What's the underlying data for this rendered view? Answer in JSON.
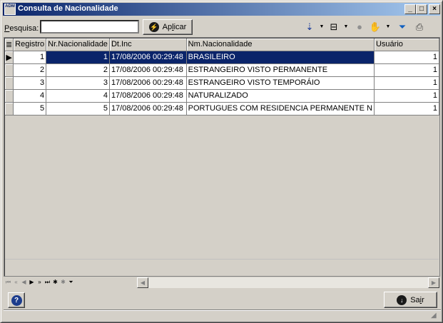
{
  "window": {
    "title": "Consulta de Nacionalidade",
    "app_icon_text": "ADM",
    "minimize_glyph": "_",
    "maximize_glyph": "□",
    "close_glyph": "×"
  },
  "search": {
    "label_underlined": "P",
    "label_rest": "esquisa:",
    "value": "",
    "placeholder": ""
  },
  "apply_button": {
    "label_pre": "Ap",
    "label_underlined": "l",
    "label_post": "icar"
  },
  "toolbar_icons": [
    "sort-icon",
    "layout-icon",
    "record-icon",
    "hand-icon",
    "filter-icon",
    "print-icon"
  ],
  "grid": {
    "columns": [
      "Registro",
      "Nr.Nacionalidade",
      "Dt.Inc",
      "Nm.Nacionalidade",
      "Usuário"
    ],
    "rows": [
      {
        "registro": "1",
        "nr": "1",
        "dt": "17/08/2006 00:29:48",
        "nm": "BRASILEIRO",
        "usuario": "1"
      },
      {
        "registro": "2",
        "nr": "2",
        "dt": "17/08/2006 00:29:48",
        "nm": "ESTRANGEIRO VISTO PERMANENTE",
        "usuario": "1"
      },
      {
        "registro": "3",
        "nr": "3",
        "dt": "17/08/2006 00:29:48",
        "nm": "ESTRANGEIRO VISTO TEMPORÁIO",
        "usuario": "1"
      },
      {
        "registro": "4",
        "nr": "4",
        "dt": "17/08/2006 00:29:48",
        "nm": "NATURALIZADO",
        "usuario": "1"
      },
      {
        "registro": "5",
        "nr": "5",
        "dt": "17/08/2006 00:29:48",
        "nm": "PORTUGUES COM RESIDENCIA PERMANENTE N",
        "usuario": "1"
      }
    ],
    "selected_row": 0,
    "row_indicator": "▶"
  },
  "navigator": {
    "first": "⏮",
    "prior_page": "«",
    "prior": "◀",
    "next": "▶",
    "next_page": "»",
    "last": "⏭",
    "insert": "✱",
    "delete": "✱",
    "filter": "⏷"
  },
  "exit_button": {
    "label_pre": "Sa",
    "label_underlined": "i",
    "label_post": "r"
  },
  "help_button": {
    "glyph": "?"
  }
}
